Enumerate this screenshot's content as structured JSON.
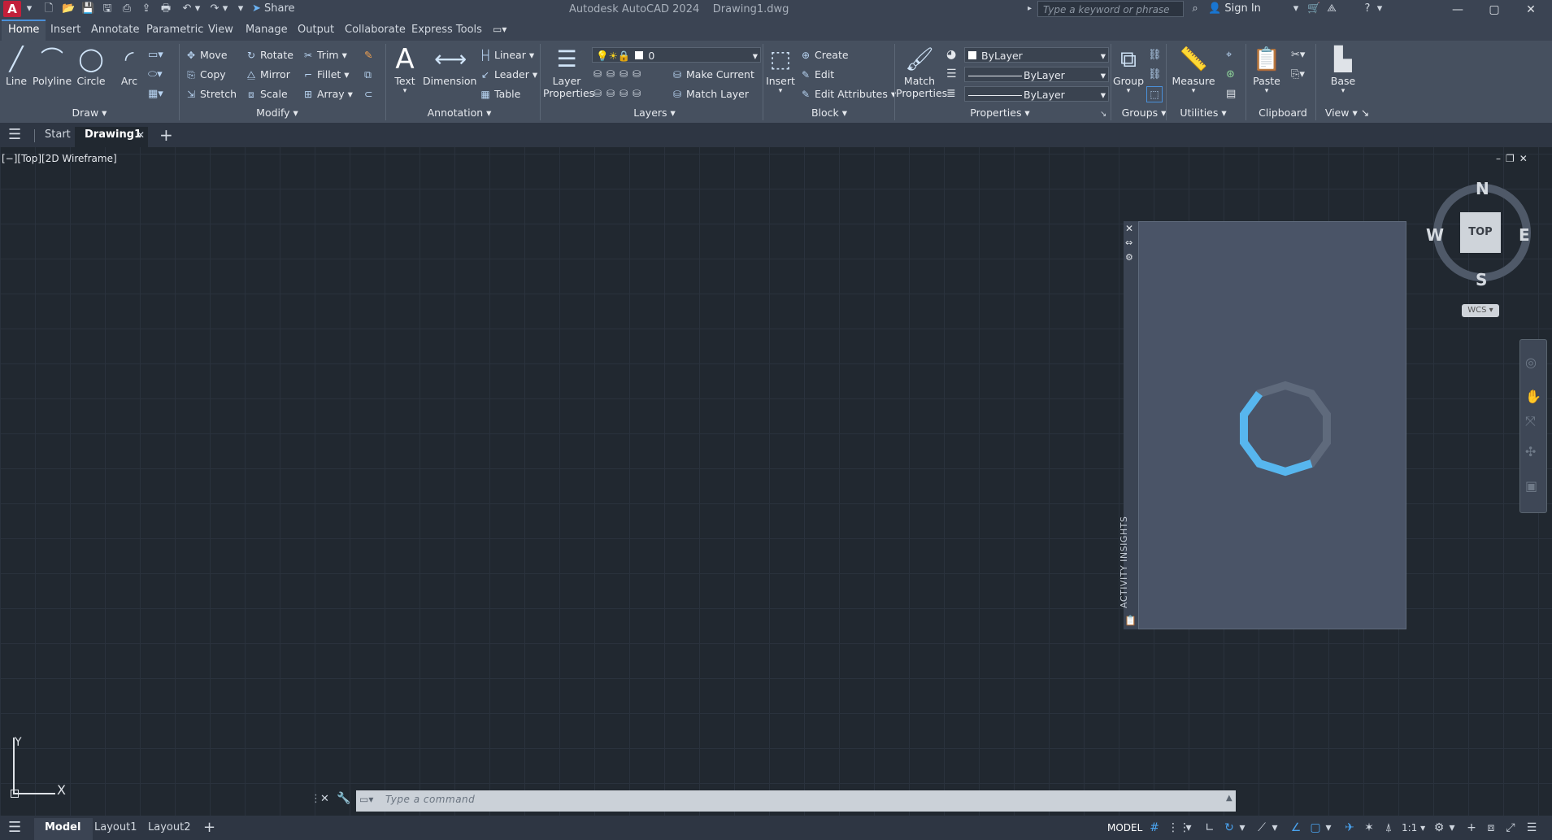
{
  "app": {
    "logo": "A",
    "title": "Autodesk AutoCAD 2024",
    "file": "Drawing1.dwg",
    "share_label": "Share",
    "search_placeholder": "Type a keyword or phrase",
    "sign_in": "Sign In"
  },
  "ribbon_tabs": [
    "Home",
    "Insert",
    "Annotate",
    "Parametric",
    "View",
    "Manage",
    "Output",
    "Collaborate",
    "Express Tools"
  ],
  "active_tab": "Home",
  "draw": {
    "line": "Line",
    "polyline": "Polyline",
    "circle": "Circle",
    "arc": "Arc",
    "title": "Draw"
  },
  "modify": {
    "move": "Move",
    "rotate": "Rotate",
    "trim": "Trim",
    "copy": "Copy",
    "mirror": "Mirror",
    "fillet": "Fillet",
    "stretch": "Stretch",
    "scale": "Scale",
    "array": "Array",
    "title": "Modify"
  },
  "annotation": {
    "text": "Text",
    "dimension": "Dimension",
    "linear": "Linear",
    "leader": "Leader",
    "table": "Table",
    "title": "Annotation"
  },
  "layers": {
    "layer_properties_1": "Layer",
    "layer_properties_2": "Properties",
    "current_layer": "0",
    "make_current": "Make Current",
    "match_layer": "Match Layer",
    "title": "Layers"
  },
  "block": {
    "insert": "Insert",
    "create": "Create",
    "edit": "Edit",
    "edit_attributes": "Edit Attributes",
    "title": "Block"
  },
  "properties": {
    "match_1": "Match",
    "match_2": "Properties",
    "color": "ByLayer",
    "linetype": "ByLayer",
    "lineweight": "ByLayer",
    "title": "Properties"
  },
  "groups": {
    "group": "Group",
    "title": "Groups"
  },
  "utilities": {
    "measure": "Measure",
    "title": "Utilities"
  },
  "clipboard": {
    "paste": "Paste",
    "title": "Clipboard"
  },
  "view": {
    "base": "Base",
    "title": "View"
  },
  "file_tabs": {
    "start": "Start",
    "drawing": "Drawing1"
  },
  "viewport_label": "[−][Top][2D Wireframe]",
  "viewcube": {
    "top": "TOP",
    "n": "N",
    "s": "S",
    "e": "E",
    "w": "W",
    "wcs": "WCS"
  },
  "insights_label": "ACTIVITY INSIGHTS",
  "ucs": {
    "x": "X",
    "y": "Y"
  },
  "command_placeholder": "Type a command",
  "status": {
    "model_tab": "Model",
    "layout1": "Layout1",
    "layout2": "Layout2",
    "model_label": "MODEL",
    "scale": "1:1"
  }
}
